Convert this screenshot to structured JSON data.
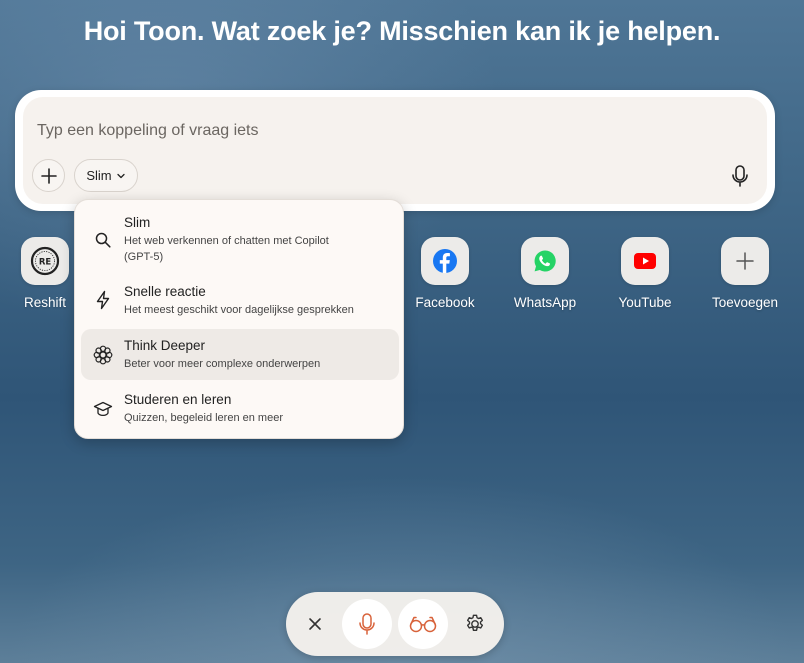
{
  "greeting": "Hoi Toon. Wat zoek je? Misschien kan ik je helpen.",
  "composer": {
    "placeholder": "Typ een koppeling of vraag iets",
    "mode_label": "Slim"
  },
  "mode_menu": {
    "items": [
      {
        "title": "Slim",
        "description": "Het web verkennen of chatten met Copilot (GPT-5)",
        "icon": "search-icon"
      },
      {
        "title": "Snelle reactie",
        "description": "Het meest geschikt voor dagelijkse gesprekken",
        "icon": "lightning-icon"
      },
      {
        "title": "Think Deeper",
        "description": "Beter voor meer complexe onderwerpen",
        "icon": "flower-icon",
        "selected": true
      },
      {
        "title": "Studeren en leren",
        "description": "Quizzen, begeleid leren en meer",
        "icon": "graduation-cap-icon"
      }
    ]
  },
  "shortcuts": [
    {
      "label": "Reshift",
      "icon": "reshift-logo-icon"
    },
    {
      "label": "Facebook",
      "icon": "facebook-icon",
      "color": "#1877f2"
    },
    {
      "label": "WhatsApp",
      "icon": "whatsapp-icon",
      "color": "#25d366"
    },
    {
      "label": "YouTube",
      "icon": "youtube-icon",
      "color": "#ff0000"
    },
    {
      "label": "Toevoegen",
      "icon": "plus-icon"
    }
  ],
  "bottom_bar": {
    "buttons": [
      "close-icon",
      "microphone-icon",
      "glasses-icon",
      "settings-icon"
    ],
    "accent_color": "#d8623a"
  }
}
